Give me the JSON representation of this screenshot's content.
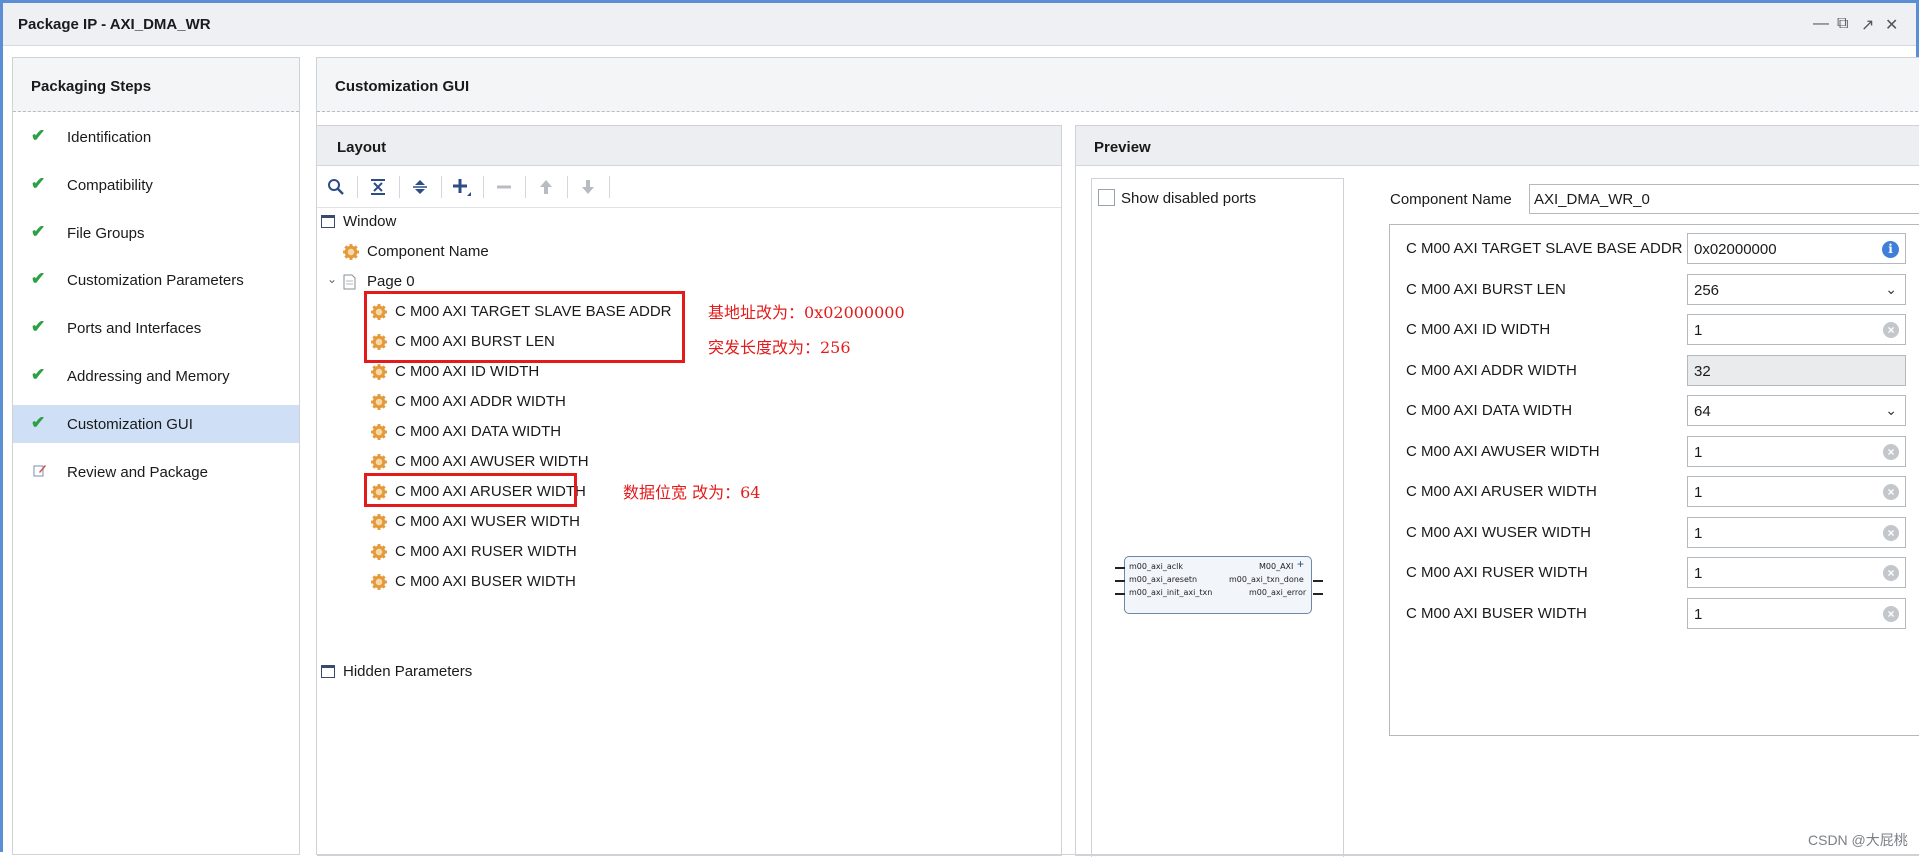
{
  "window": {
    "title": "Package IP - AXI_DMA_WR"
  },
  "steps": {
    "title": "Packaging Steps",
    "items": [
      {
        "label": "Identification",
        "icon": "check-icon"
      },
      {
        "label": "Compatibility",
        "icon": "check-icon"
      },
      {
        "label": "File Groups",
        "icon": "check-icon"
      },
      {
        "label": "Customization Parameters",
        "icon": "check-icon"
      },
      {
        "label": "Ports and Interfaces",
        "icon": "check-icon"
      },
      {
        "label": "Addressing and Memory",
        "icon": "check-icon"
      },
      {
        "label": "Customization GUI",
        "icon": "check-icon",
        "selected": true
      },
      {
        "label": "Review and Package",
        "icon": "edit-icon"
      }
    ]
  },
  "main": {
    "title": "Customization GUI"
  },
  "layout": {
    "title": "Layout",
    "toolbar": [
      "search-icon",
      "collapse-all-icon",
      "expand-all-icon",
      "add-icon",
      "remove-icon",
      "move-up-icon",
      "move-down-icon"
    ],
    "tree": {
      "window": "Window",
      "component_name": "Component Name",
      "page": "Page 0",
      "params": [
        "C M00 AXI TARGET SLAVE BASE ADDR",
        "C M00 AXI BURST LEN",
        "C M00 AXI ID WIDTH",
        "C M00 AXI ADDR WIDTH",
        "C M00 AXI DATA WIDTH",
        "C M00 AXI AWUSER WIDTH",
        "C M00 AXI ARUSER WIDTH",
        "C M00 AXI WUSER WIDTH",
        "C M00 AXI RUSER WIDTH",
        "C M00 AXI BUSER WIDTH"
      ],
      "hidden": "Hidden Parameters"
    }
  },
  "annotations": {
    "base_addr": "基地址改为：0x02000000",
    "burst_len": "突发长度改为：256",
    "data_width": "数据位宽 改为：64",
    "color": "#e41b1b"
  },
  "preview": {
    "title": "Preview",
    "show_disabled_ports": "Show disabled ports",
    "block": {
      "left_ports": [
        "m00_axi_aclk",
        "m00_axi_aresetn",
        "m00_axi_init_axi_txn"
      ],
      "right_ports": [
        "M00_AXI",
        "m00_axi_txn_done",
        "m00_axi_error"
      ]
    },
    "component_name_label": "Component Name",
    "component_name_value": "AXI_DMA_WR_0",
    "params": [
      {
        "label": "C M00 AXI TARGET SLAVE BASE ADDR",
        "value": "0x02000000",
        "kind": "info"
      },
      {
        "label": "C M00 AXI BURST LEN",
        "value": "256",
        "kind": "dropdown"
      },
      {
        "label": "C M00 AXI ID WIDTH",
        "value": "1",
        "kind": "clear"
      },
      {
        "label": "C M00 AXI ADDR WIDTH",
        "value": "32",
        "kind": "disabled"
      },
      {
        "label": "C M00 AXI DATA WIDTH",
        "value": "64",
        "kind": "dropdown"
      },
      {
        "label": "C M00 AXI AWUSER WIDTH",
        "value": "1",
        "kind": "clear"
      },
      {
        "label": "C M00 AXI ARUSER WIDTH",
        "value": "1",
        "kind": "clear"
      },
      {
        "label": "C M00 AXI WUSER WIDTH",
        "value": "1",
        "kind": "clear"
      },
      {
        "label": "C M00 AXI RUSER WIDTH",
        "value": "1",
        "kind": "clear"
      },
      {
        "label": "C M00 AXI BUSER WIDTH",
        "value": "1",
        "kind": "clear"
      }
    ]
  },
  "watermark": "CSDN @大屁桃"
}
